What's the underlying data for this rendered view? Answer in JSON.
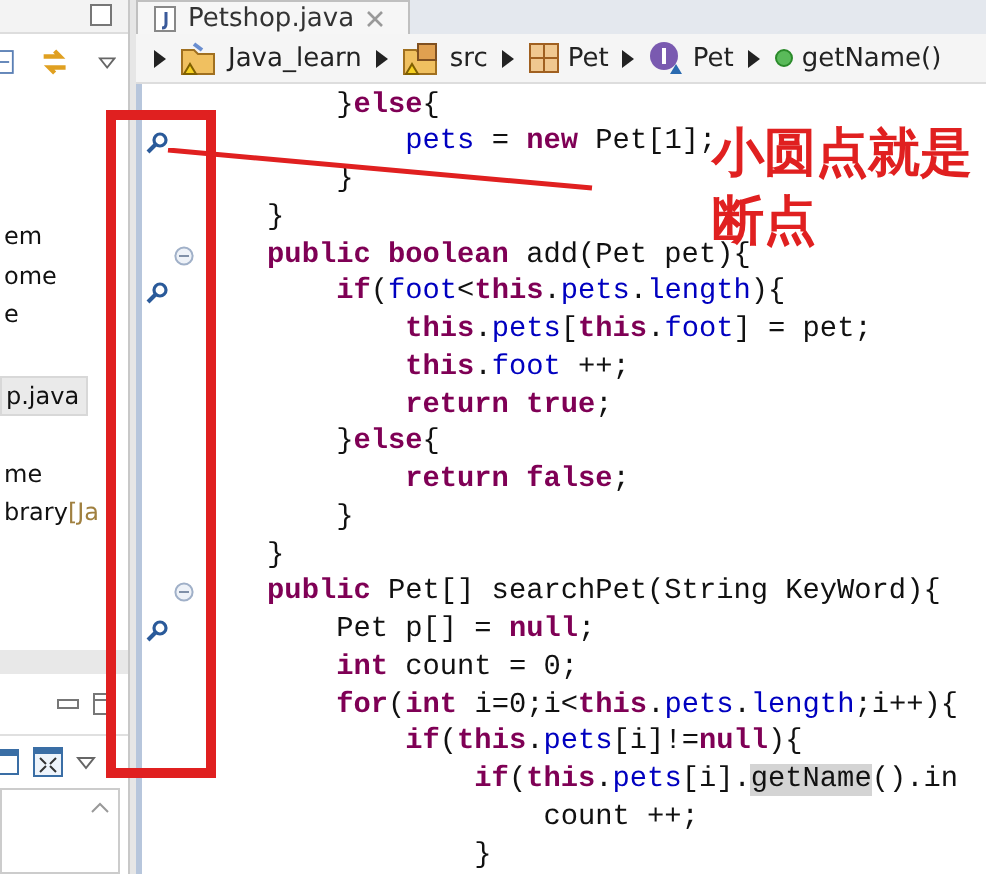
{
  "explorer": {
    "items": [
      {
        "label": "em",
        "selected": false
      },
      {
        "label": "ome",
        "selected": false
      },
      {
        "label": "e",
        "selected": false
      },
      {
        "label": "p.java",
        "selected": true
      },
      {
        "label": "me",
        "selected": false
      },
      {
        "label": "brary",
        "decoration": "[Ja",
        "selected": false
      }
    ]
  },
  "editor": {
    "tab": {
      "title": "Petshop.java"
    },
    "breadcrumb": [
      {
        "label": "Java_learn",
        "kind": "project"
      },
      {
        "label": "src",
        "kind": "folder"
      },
      {
        "label": "Pet",
        "kind": "package"
      },
      {
        "label": "Pet",
        "kind": "interface"
      },
      {
        "label": "getName()",
        "kind": "method"
      }
    ],
    "lines": [
      {
        "breakpoint": false,
        "fold": false,
        "tokens": [
          {
            "text": "        }",
            "kind": "plain"
          },
          {
            "text": "else",
            "kind": "keyword"
          },
          {
            "text": "{",
            "kind": "plain"
          }
        ]
      },
      {
        "breakpoint": true,
        "fold": false,
        "tokens": [
          {
            "text": "            pets",
            "kind": "field"
          },
          {
            "text": " = ",
            "kind": "plain"
          },
          {
            "text": "new",
            "kind": "keyword"
          },
          {
            "text": " Pet[1];",
            "kind": "plain"
          }
        ]
      },
      {
        "breakpoint": false,
        "fold": false,
        "tokens": [
          {
            "text": "        }",
            "kind": "plain"
          }
        ]
      },
      {
        "breakpoint": false,
        "fold": false,
        "tokens": [
          {
            "text": "    }",
            "kind": "plain"
          }
        ]
      },
      {
        "breakpoint": false,
        "fold": true,
        "tokens": [
          {
            "text": "    public boolean",
            "kind": "keyword"
          },
          {
            "text": " add(Pet pet){",
            "kind": "plain"
          }
        ]
      },
      {
        "breakpoint": true,
        "fold": false,
        "tokens": [
          {
            "text": "        if",
            "kind": "keyword"
          },
          {
            "text": "(",
            "kind": "plain"
          },
          {
            "text": "foot",
            "kind": "field"
          },
          {
            "text": "<",
            "kind": "plain"
          },
          {
            "text": "this",
            "kind": "keyword"
          },
          {
            "text": ".",
            "kind": "plain"
          },
          {
            "text": "pets",
            "kind": "field"
          },
          {
            "text": ".",
            "kind": "plain"
          },
          {
            "text": "length",
            "kind": "field"
          },
          {
            "text": "){",
            "kind": "plain"
          }
        ]
      },
      {
        "breakpoint": false,
        "fold": false,
        "tokens": [
          {
            "text": "            this",
            "kind": "keyword"
          },
          {
            "text": ".",
            "kind": "plain"
          },
          {
            "text": "pets",
            "kind": "field"
          },
          {
            "text": "[",
            "kind": "plain"
          },
          {
            "text": "this",
            "kind": "keyword"
          },
          {
            "text": ".",
            "kind": "plain"
          },
          {
            "text": "foot",
            "kind": "field"
          },
          {
            "text": "] = pet;",
            "kind": "plain"
          }
        ]
      },
      {
        "breakpoint": false,
        "fold": false,
        "tokens": [
          {
            "text": "            this",
            "kind": "keyword"
          },
          {
            "text": ".",
            "kind": "plain"
          },
          {
            "text": "foot",
            "kind": "field"
          },
          {
            "text": " ++;",
            "kind": "plain"
          }
        ]
      },
      {
        "breakpoint": false,
        "fold": false,
        "tokens": [
          {
            "text": "            return true",
            "kind": "keyword"
          },
          {
            "text": ";",
            "kind": "plain"
          }
        ]
      },
      {
        "breakpoint": false,
        "fold": false,
        "tokens": [
          {
            "text": "        }",
            "kind": "plain"
          },
          {
            "text": "else",
            "kind": "keyword"
          },
          {
            "text": "{",
            "kind": "plain"
          }
        ]
      },
      {
        "breakpoint": false,
        "fold": false,
        "tokens": [
          {
            "text": "            return false",
            "kind": "keyword"
          },
          {
            "text": ";",
            "kind": "plain"
          }
        ]
      },
      {
        "breakpoint": false,
        "fold": false,
        "tokens": [
          {
            "text": "        }",
            "kind": "plain"
          }
        ]
      },
      {
        "breakpoint": false,
        "fold": false,
        "tokens": [
          {
            "text": "    }",
            "kind": "plain"
          }
        ]
      },
      {
        "breakpoint": false,
        "fold": true,
        "tokens": [
          {
            "text": "    public",
            "kind": "keyword"
          },
          {
            "text": " Pet[] searchPet(String KeyWord){",
            "kind": "plain"
          }
        ]
      },
      {
        "breakpoint": true,
        "fold": false,
        "tokens": [
          {
            "text": "        Pet p[] = ",
            "kind": "plain"
          },
          {
            "text": "null",
            "kind": "keyword"
          },
          {
            "text": ";",
            "kind": "plain"
          }
        ]
      },
      {
        "breakpoint": false,
        "fold": false,
        "tokens": [
          {
            "text": "        int",
            "kind": "keyword"
          },
          {
            "text": " count = 0;",
            "kind": "plain"
          }
        ]
      },
      {
        "breakpoint": false,
        "fold": false,
        "tokens": [
          {
            "text": "        for",
            "kind": "keyword"
          },
          {
            "text": "(",
            "kind": "plain"
          },
          {
            "text": "int",
            "kind": "keyword"
          },
          {
            "text": " i=0;i<",
            "kind": "plain"
          },
          {
            "text": "this",
            "kind": "keyword"
          },
          {
            "text": ".",
            "kind": "plain"
          },
          {
            "text": "pets",
            "kind": "field"
          },
          {
            "text": ".",
            "kind": "plain"
          },
          {
            "text": "length",
            "kind": "field"
          },
          {
            "text": ";i++){",
            "kind": "plain"
          }
        ]
      },
      {
        "breakpoint": false,
        "fold": false,
        "tokens": [
          {
            "text": "            if",
            "kind": "keyword"
          },
          {
            "text": "(",
            "kind": "plain"
          },
          {
            "text": "this",
            "kind": "keyword"
          },
          {
            "text": ".",
            "kind": "plain"
          },
          {
            "text": "pets",
            "kind": "field"
          },
          {
            "text": "[i]!=",
            "kind": "plain"
          },
          {
            "text": "null",
            "kind": "keyword"
          },
          {
            "text": "){",
            "kind": "plain"
          }
        ]
      },
      {
        "breakpoint": false,
        "fold": false,
        "tokens": [
          {
            "text": "                if",
            "kind": "keyword"
          },
          {
            "text": "(",
            "kind": "plain"
          },
          {
            "text": "this",
            "kind": "keyword"
          },
          {
            "text": ".",
            "kind": "plain"
          },
          {
            "text": "pets",
            "kind": "field"
          },
          {
            "text": "[i].",
            "kind": "plain"
          },
          {
            "text": "getName",
            "kind": "occurrence"
          },
          {
            "text": "().in",
            "kind": "plain"
          }
        ]
      },
      {
        "breakpoint": false,
        "fold": false,
        "tokens": [
          {
            "text": "                    count ++;",
            "kind": "plain"
          }
        ]
      },
      {
        "breakpoint": false,
        "fold": false,
        "tokens": [
          {
            "text": "                }",
            "kind": "plain"
          }
        ]
      }
    ]
  },
  "annotation": {
    "lines": [
      "小圆点就是",
      "断点"
    ]
  }
}
